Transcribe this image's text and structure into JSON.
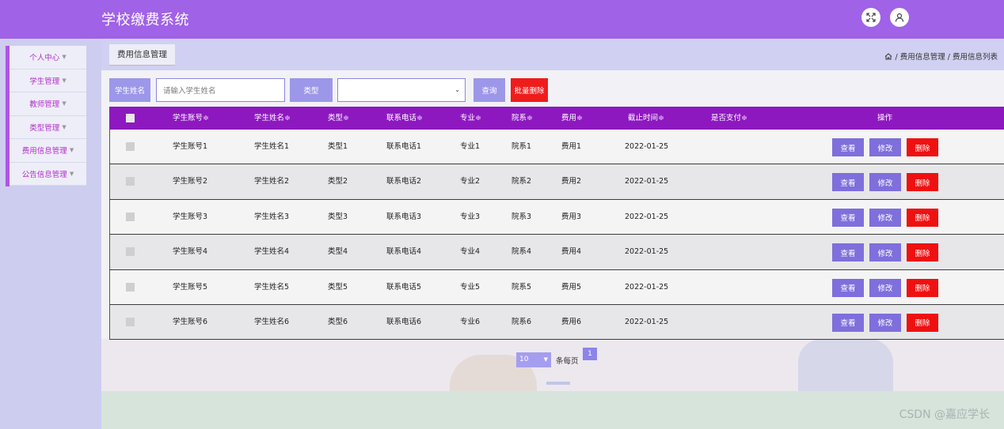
{
  "app": {
    "title": "学校缴费系统"
  },
  "header": {
    "icons": [
      "fullscreen-icon",
      "user-icon"
    ]
  },
  "sidebar": {
    "items": [
      {
        "label": "个人中心"
      },
      {
        "label": "学生管理"
      },
      {
        "label": "教师管理"
      },
      {
        "label": "类型管理"
      },
      {
        "label": "费用信息管理"
      },
      {
        "label": "公告信息管理"
      }
    ]
  },
  "page": {
    "tab_title": "费用信息管理",
    "breadcrumb": {
      "home_icon": "home-icon",
      "level1": "费用信息管理",
      "level2": "费用信息列表",
      "separator": "/"
    }
  },
  "search": {
    "name_label": "学生姓名",
    "name_placeholder": "请输入学生姓名",
    "type_label": "类型",
    "type_value": "",
    "query_label": "查询",
    "batch_delete_label": "批量删除"
  },
  "table": {
    "columns": [
      "学生账号",
      "学生姓名",
      "类型",
      "联系电话",
      "专业",
      "院系",
      "费用",
      "截止时间",
      "是否支付",
      "操作"
    ],
    "sort_glyph": "≑",
    "rows": [
      {
        "account": "学生账号1",
        "name": "学生姓名1",
        "type": "类型1",
        "phone": "联系电话1",
        "major": "专业1",
        "dept": "院系1",
        "fee": "费用1",
        "deadline": "2022-01-25",
        "paid": ""
      },
      {
        "account": "学生账号2",
        "name": "学生姓名2",
        "type": "类型2",
        "phone": "联系电话2",
        "major": "专业2",
        "dept": "院系2",
        "fee": "费用2",
        "deadline": "2022-01-25",
        "paid": ""
      },
      {
        "account": "学生账号3",
        "name": "学生姓名3",
        "type": "类型3",
        "phone": "联系电话3",
        "major": "专业3",
        "dept": "院系3",
        "fee": "费用3",
        "deadline": "2022-01-25",
        "paid": ""
      },
      {
        "account": "学生账号4",
        "name": "学生姓名4",
        "type": "类型4",
        "phone": "联系电话4",
        "major": "专业4",
        "dept": "院系4",
        "fee": "费用4",
        "deadline": "2022-01-25",
        "paid": ""
      },
      {
        "account": "学生账号5",
        "name": "学生姓名5",
        "type": "类型5",
        "phone": "联系电话5",
        "major": "专业5",
        "dept": "院系5",
        "fee": "费用5",
        "deadline": "2022-01-25",
        "paid": ""
      },
      {
        "account": "学生账号6",
        "name": "学生姓名6",
        "type": "类型6",
        "phone": "联系电话6",
        "major": "专业6",
        "dept": "院系6",
        "fee": "费用6",
        "deadline": "2022-01-25",
        "paid": ""
      }
    ],
    "actions": {
      "view": "查看",
      "edit": "修改",
      "delete": "删除"
    }
  },
  "pagination": {
    "page_size": "10",
    "per_page_label": "条每页",
    "current_page": "1"
  },
  "watermark": "CSDN @嘉应学长",
  "colors": {
    "topbar": "#a062e6",
    "table_header": "#8e18c0",
    "danger": "#ef1c1c",
    "accent": "#9d97ea"
  }
}
